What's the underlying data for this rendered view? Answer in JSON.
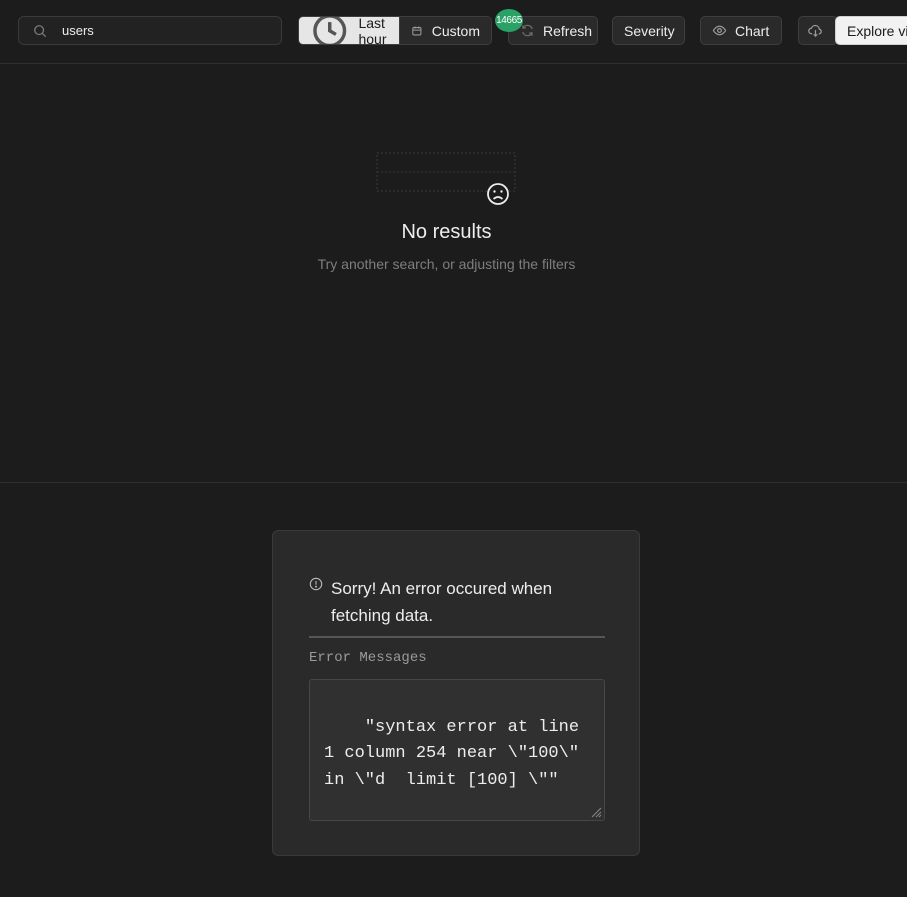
{
  "toolbar": {
    "search": {
      "value": "users",
      "icon": "search-icon"
    },
    "time_range": {
      "last_hour_label": "Last hour",
      "custom_label": "Custom"
    },
    "refresh_badge": "14665",
    "refresh_label": "Refresh",
    "severity_label": "Severity",
    "chart_label": "Chart",
    "explore_label": "Explore via"
  },
  "results": {
    "title": "No results",
    "hint": "Try another search, or adjusting the filters"
  },
  "error": {
    "title": "Sorry! An error occured when fetching data.",
    "messages_label": "Error Messages",
    "message": "\"syntax error at line 1 column 254 near \\\"100\\\" in \\\"d  limit [100] \\\"\""
  },
  "colors": {
    "background": "#1c1c1c",
    "card": "#2a2a2a",
    "badge": "#2aa267",
    "active_segment": "#e6e6e6"
  }
}
